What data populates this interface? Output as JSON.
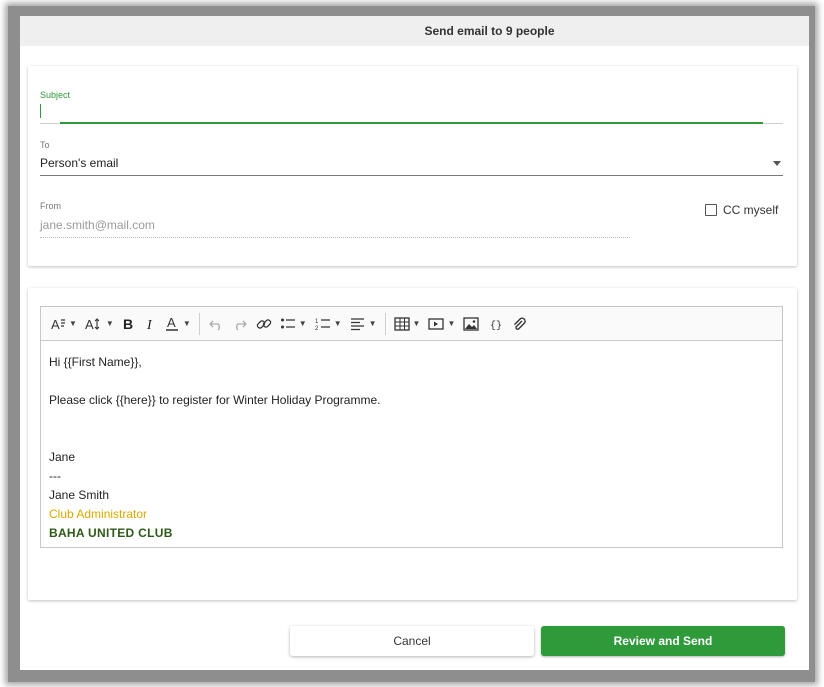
{
  "dialog": {
    "title": "Send email to 9 people"
  },
  "form": {
    "subject_label": "Subject",
    "subject_value": "",
    "to_label": "To",
    "to_value": "Person's email",
    "from_label": "From",
    "from_value": "jane.smith@mail.com",
    "cc_label": "CC myself",
    "cc_checked": false
  },
  "toolbar": {
    "icons": [
      "font-style-icon",
      "font-size-icon",
      "bold-icon",
      "italic-icon",
      "text-color-icon",
      "undo-icon",
      "redo-icon",
      "link-icon",
      "bullet-list-icon",
      "numbered-list-icon",
      "align-icon",
      "table-icon",
      "video-icon",
      "image-icon",
      "code-icon",
      "attachment-icon"
    ]
  },
  "message": {
    "greeting": "Hi {{First Name}},",
    "body": "Please click {{here}} to register for Winter Holiday Programme.",
    "sign_name": "Jane",
    "sign_dashes": "---",
    "sign_full_name": "Jane Smith",
    "sign_role": "Club Administrator",
    "sign_club": "BAHA UNITED CLUB",
    "colors": {
      "role": "#d8a800",
      "club": "#2d5a16"
    }
  },
  "actions": {
    "cancel_label": "Cancel",
    "send_label": "Review and Send",
    "accent_color": "#2f9a3a"
  }
}
